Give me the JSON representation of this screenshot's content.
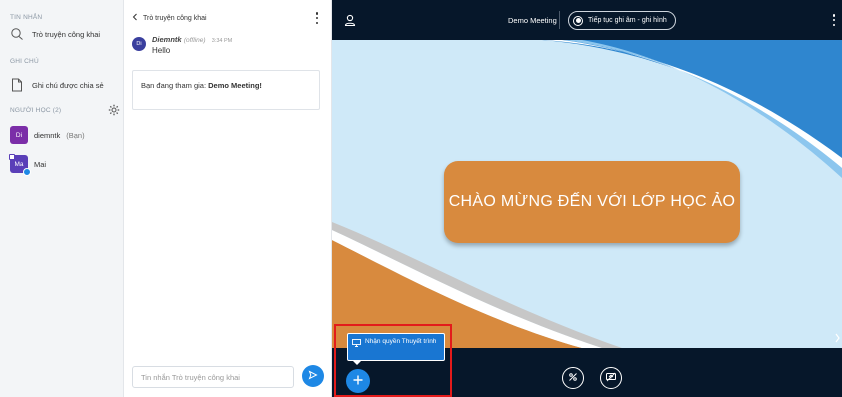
{
  "sidebar": {
    "messages_heading": "TIN NHẮN",
    "public_chat_label": "Trò truyện công khai",
    "notes_heading": "GHI CHÚ",
    "shared_notes_label": "Ghi chú được chia sẻ",
    "users_heading": "NGƯỜI HỌC (2)",
    "users": [
      {
        "initials": "Di",
        "name": "diemntk",
        "suffix": "(Bạn)"
      },
      {
        "initials": "Ma",
        "name": "Mai",
        "suffix": ""
      }
    ],
    "icons": {
      "chat": "chat-bubbles-icon",
      "notes": "document-icon",
      "settings": "gear-icon"
    }
  },
  "chat": {
    "back_label": "Trò truyện công khai",
    "message": {
      "avatar_initials": "Di",
      "sender": "Diemntk",
      "status": "(offline)",
      "time": "3:34 PM",
      "text": "Hello"
    },
    "welcome_prefix": "Bạn đang tham gia: ",
    "welcome_meeting": "Demo Meeting",
    "welcome_suffix": "!",
    "input_placeholder": "Tin nhắn Trò truyện công khai"
  },
  "stage": {
    "meeting_title": "Demo Meeting",
    "record_label": "Tiếp tục ghi âm - ghi hình",
    "slide_title": "CHÀO MỪNG ĐẾN VỚI LỚP HỌC ẢO",
    "popup_label": "Nhận quyền Thuyết trình",
    "colors": {
      "accent": "#1e88e5",
      "stage_bg": "#06172a",
      "slide_orange": "#d88a3e",
      "highlight": "#e31b1b"
    }
  }
}
